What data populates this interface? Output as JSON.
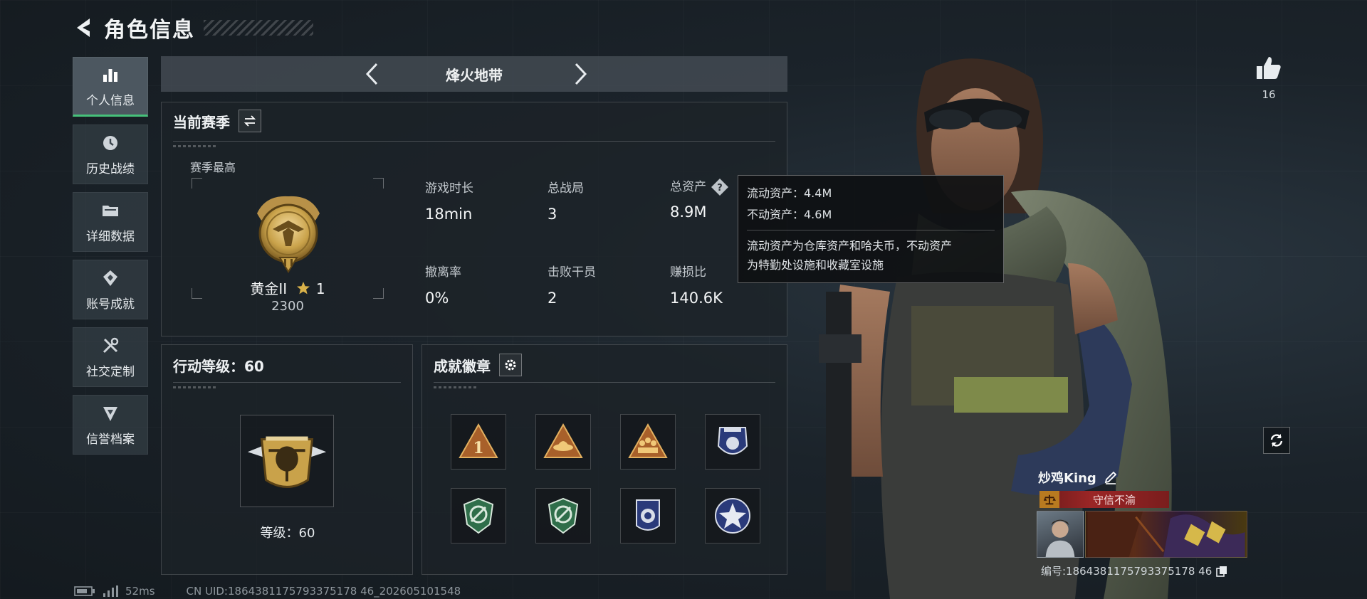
{
  "header": {
    "title": "角色信息"
  },
  "sidebar": {
    "items": [
      {
        "label": "个人信息",
        "icon": "bar-chart-icon",
        "active": true
      },
      {
        "label": "历史战绩",
        "icon": "clock-icon"
      },
      {
        "label": "详细数据",
        "icon": "folder-icon"
      },
      {
        "label": "账号成就",
        "icon": "achievement-icon"
      },
      {
        "label": "社交定制",
        "icon": "tools-icon"
      },
      {
        "label": "信誉档案",
        "icon": "shield-icon"
      }
    ]
  },
  "mode": {
    "title": "烽火地带"
  },
  "season": {
    "title": "当前赛季",
    "best_caption": "赛季最高",
    "rank_name": "黄金II",
    "rank_stars": "1",
    "rank_score": "2300",
    "stats": [
      {
        "label": "游戏时长",
        "value": "18min"
      },
      {
        "label": "总战局",
        "value": "3"
      },
      {
        "label": "总资产",
        "value": "8.9M"
      },
      {
        "label": "撤离率",
        "value": "0%"
      },
      {
        "label": "击败干员",
        "value": "2"
      },
      {
        "label": "赚损比",
        "value": "140.6K"
      }
    ]
  },
  "tooltip": {
    "liquid": "流动资产：4.4M",
    "fixed": "不动资产：4.6M",
    "note_line1": "流动资产为仓库资产和哈夫币，不动资产",
    "note_line2": "为特勤处设施和收藏室设施"
  },
  "level": {
    "title": "行动等级：60",
    "text": "等级：60"
  },
  "badges": {
    "title": "成就徽章",
    "items": [
      {
        "icon": "triangle-badge-one-icon"
      },
      {
        "icon": "triangle-badge-hat-icon"
      },
      {
        "icon": "triangle-badge-squad-icon"
      },
      {
        "icon": "police-badge-icon"
      },
      {
        "icon": "green-shield-badge-icon"
      },
      {
        "icon": "green-shield-badge-icon"
      },
      {
        "icon": "police-badge-blue-icon"
      },
      {
        "icon": "star-badge-icon"
      }
    ]
  },
  "footer": {
    "ping": "52ms",
    "uid": "CN UID:1864381175793375178 46_202605101548"
  },
  "social": {
    "like_count": "16"
  },
  "player": {
    "name": "炒鸡King",
    "title": "守信不渝",
    "uid": "编号:1864381175793375178 46"
  },
  "colors": {
    "accent_green": "#46c17a",
    "title_red": "#9b2626",
    "gold": "#c9a24a"
  }
}
